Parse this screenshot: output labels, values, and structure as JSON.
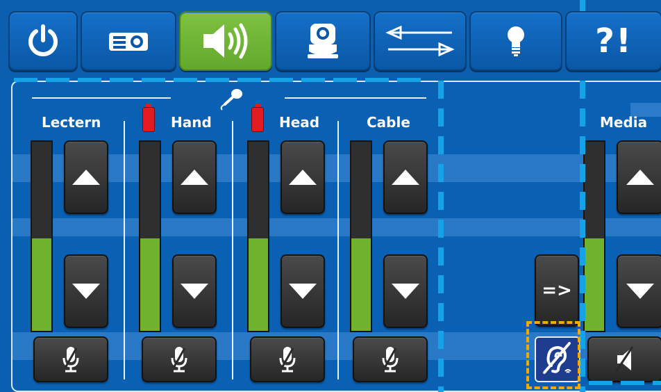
{
  "tabs": [
    {
      "id": "power",
      "icon": "power-icon",
      "active": false
    },
    {
      "id": "projector",
      "icon": "projector-icon",
      "active": false
    },
    {
      "id": "audio",
      "icon": "speaker-icon",
      "active": true
    },
    {
      "id": "camera",
      "icon": "camera-icon",
      "active": false
    },
    {
      "id": "switching",
      "icon": "switch-arrows-icon",
      "active": false
    },
    {
      "id": "lights",
      "icon": "lightbulb-icon",
      "active": false
    },
    {
      "id": "help",
      "icon": "help-text",
      "active": false,
      "label": "?!"
    }
  ],
  "mic_group_icon": "microphone-icon",
  "channels": [
    {
      "label": "Lectern",
      "level": 0.49,
      "battery": false,
      "mute_icon": "mic-mute-icon"
    },
    {
      "label": "Hand",
      "level": 0.49,
      "battery": true,
      "mute_icon": "mic-mute-icon"
    },
    {
      "label": "Head",
      "level": 0.49,
      "battery": true,
      "mute_icon": "mic-mute-icon"
    },
    {
      "label": "Cable",
      "level": 0.49,
      "battery": false,
      "mute_icon": "mic-mute-icon"
    }
  ],
  "route_button_label": "=>",
  "hearing_loop_icon": "hearing-loop-icon",
  "media": {
    "label": "Media",
    "level": 0.49,
    "mute_icon": "speaker-mute-icon"
  },
  "colors": {
    "accent_green": "#6fb22c",
    "active_tab": "#7fc241",
    "battery_red": "#e21b22",
    "panel_blue": "#0a61b3"
  }
}
